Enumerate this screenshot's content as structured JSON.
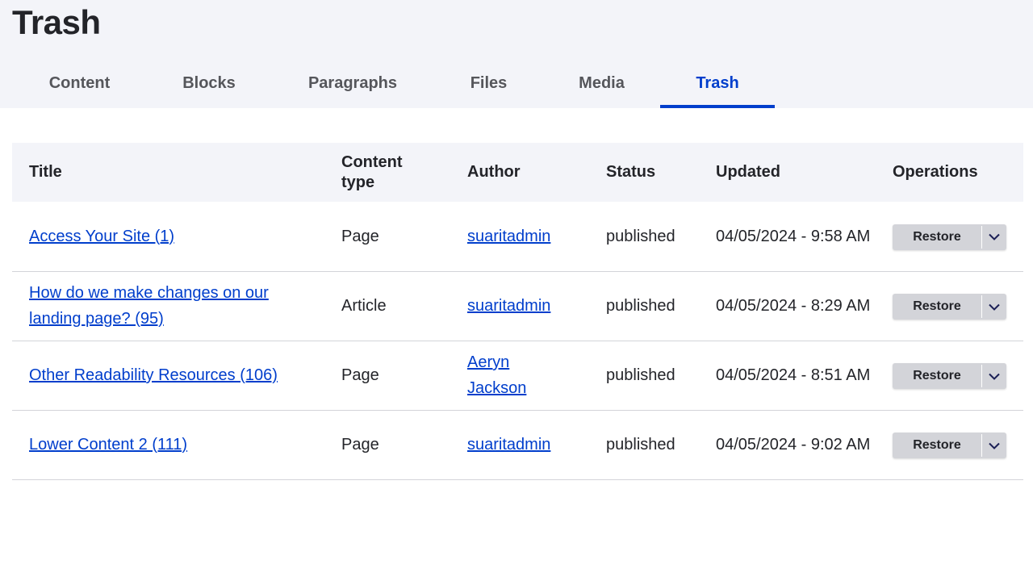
{
  "page": {
    "title": "Trash"
  },
  "tabs": [
    {
      "label": "Content",
      "active": false
    },
    {
      "label": "Blocks",
      "active": false
    },
    {
      "label": "Paragraphs",
      "active": false
    },
    {
      "label": "Files",
      "active": false
    },
    {
      "label": "Media",
      "active": false
    },
    {
      "label": "Trash",
      "active": true
    }
  ],
  "table": {
    "headers": {
      "title": "Title",
      "content_type": "Content type",
      "author": "Author",
      "status": "Status",
      "updated": "Updated",
      "operations": "Operations"
    },
    "rows": [
      {
        "title": "Access Your Site (1)",
        "content_type": "Page",
        "author": "suaritadmin",
        "status": "published",
        "updated": "04/05/2024 - 9:58 AM",
        "operation": "Restore"
      },
      {
        "title": "How do we make changes on our landing page? (95)",
        "content_type": "Article",
        "author": "suaritadmin",
        "status": "published",
        "updated": "04/05/2024 - 8:29 AM",
        "operation": "Restore"
      },
      {
        "title": "Other Readability Resources (106)",
        "content_type": "Page",
        "author": "Aeryn Jackson",
        "status": "published",
        "updated": "04/05/2024 - 8:51 AM",
        "operation": "Restore"
      },
      {
        "title": "Lower Content 2 (111)",
        "content_type": "Page",
        "author": "suaritadmin",
        "status": "published",
        "updated": "04/05/2024 - 9:02 AM",
        "operation": "Restore"
      }
    ]
  },
  "colors": {
    "accent": "#003ecc",
    "header_bg": "#f3f4f9",
    "button_bg": "#d3d4d9"
  }
}
